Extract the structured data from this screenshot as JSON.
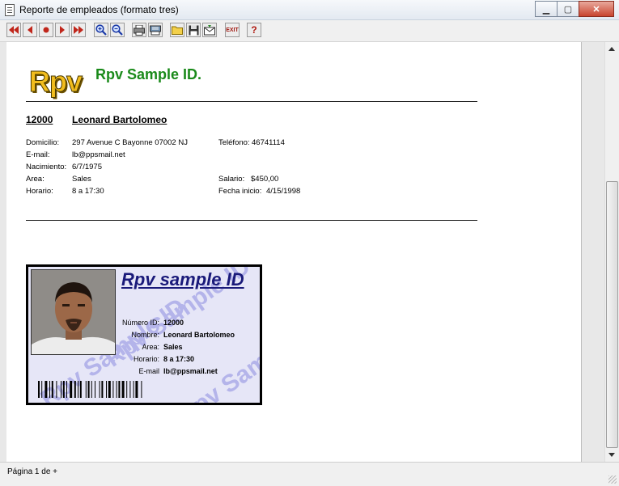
{
  "window": {
    "title": "Reporte de empleados (formato tres)",
    "icon": "document-icon"
  },
  "toolbar": {
    "buttons": [
      {
        "name": "first-page-button",
        "icon": "double-left-arrow"
      },
      {
        "name": "prev-page-button",
        "icon": "left-arrow"
      },
      {
        "name": "stop-button",
        "icon": "red-dot"
      },
      {
        "name": "next-page-button",
        "icon": "right-arrow"
      },
      {
        "name": "last-page-button",
        "icon": "double-right-arrow"
      },
      {
        "name": "zoom-in-button",
        "icon": "magnifier-plus"
      },
      {
        "name": "zoom-out-button",
        "icon": "magnifier-minus"
      },
      {
        "name": "print-button",
        "icon": "printer"
      },
      {
        "name": "print-setup-button",
        "icon": "printer-setup"
      },
      {
        "name": "open-button",
        "icon": "folder"
      },
      {
        "name": "save-button",
        "icon": "floppy-disk"
      },
      {
        "name": "email-button",
        "icon": "envelope"
      },
      {
        "name": "exit-button",
        "icon": "exit",
        "label": "EXIT"
      },
      {
        "name": "help-button",
        "icon": "question-mark",
        "label": "?"
      }
    ]
  },
  "report": {
    "logo_text": "Rpv",
    "title": "Rpv Sample ID.",
    "employee": {
      "id": "12000",
      "name": "Leonard Bartolomeo",
      "fields": [
        {
          "label": "Domicilio:",
          "value": "297 Avenue C Bayonne 07002 NJ"
        },
        {
          "label": "E-mail:",
          "value": "lb@ppsmail.net"
        },
        {
          "label": "Nacimiento:",
          "value": "6/7/1975"
        },
        {
          "label": "Area:",
          "value": "Sales"
        },
        {
          "label": "Horario:",
          "value": "8 a 17:30"
        }
      ],
      "right_fields": [
        {
          "label": "Teléfono:",
          "value": "46741114"
        },
        {
          "label": "Salario:",
          "value": "$450,00"
        },
        {
          "label": "Fecha inicio:",
          "value": "4/15/1998"
        }
      ]
    },
    "id_card": {
      "title": "Rpv sample ID",
      "watermark": "Rpv Sample ID",
      "fields": [
        {
          "label": "Número ID:",
          "value": "12000"
        },
        {
          "label": "Nombre:",
          "value": "Leonard Bartolomeo"
        },
        {
          "label": "Area:",
          "value": "Sales"
        },
        {
          "label": "Horario:",
          "value": "8 a 17:30"
        },
        {
          "label": "E-mail",
          "value": "lb@ppsmail.net"
        }
      ]
    }
  },
  "status_bar": {
    "page_text": "Página 1 de +"
  },
  "colors": {
    "report_title": "#1a8a1a",
    "card_title": "#1a1a7a",
    "card_background": "#e6e6f7",
    "watermark": "#b4b4ea",
    "logo": "#f2bd1d"
  }
}
